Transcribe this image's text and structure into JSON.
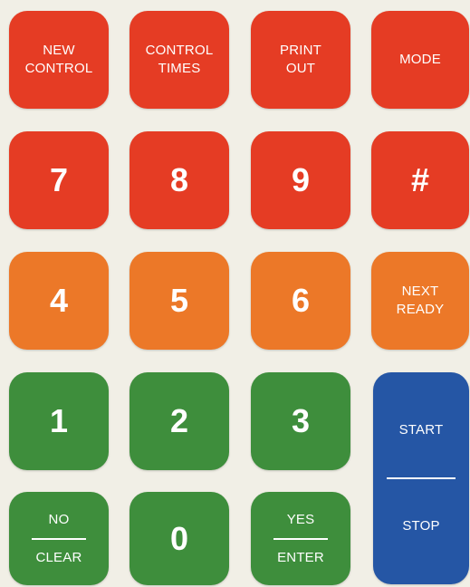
{
  "keypad": {
    "colors": {
      "background": "#f1efe6",
      "red": "#e53c24",
      "orange": "#ec7828",
      "green": "#3e8e3c",
      "blue": "#2556a5",
      "text": "#ffffff"
    },
    "keys": {
      "new_control": {
        "line1": "NEW",
        "line2": "CONTROL"
      },
      "control_times": {
        "line1": "CONTROL",
        "line2": "TIMES"
      },
      "print_out": {
        "line1": "PRINT",
        "line2": "OUT"
      },
      "mode": {
        "label": "MODE"
      },
      "seven": {
        "label": "7"
      },
      "eight": {
        "label": "8"
      },
      "nine": {
        "label": "9"
      },
      "hash": {
        "label": "#"
      },
      "four": {
        "label": "4"
      },
      "five": {
        "label": "5"
      },
      "six": {
        "label": "6"
      },
      "next_ready": {
        "line1": "NEXT",
        "line2": "READY"
      },
      "one": {
        "label": "1"
      },
      "two": {
        "label": "2"
      },
      "three": {
        "label": "3"
      },
      "start_stop": {
        "top": "START",
        "bottom": "STOP"
      },
      "no_clear": {
        "top": "NO",
        "bottom": "CLEAR"
      },
      "zero": {
        "label": "0"
      },
      "yes_enter": {
        "top": "YES",
        "bottom": "ENTER"
      }
    }
  }
}
